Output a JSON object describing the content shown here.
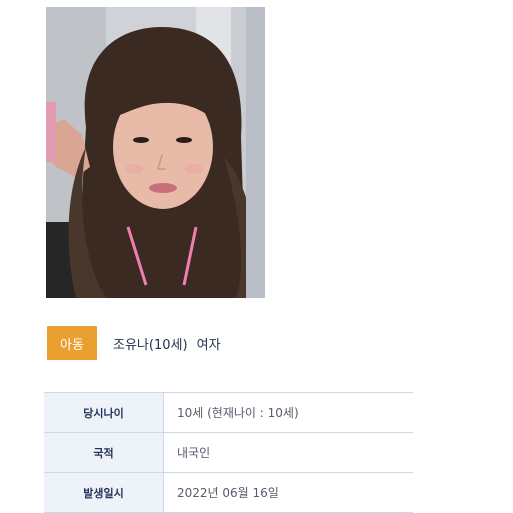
{
  "photo": {
    "icon": "child-photo"
  },
  "profile": {
    "category_badge": "아동",
    "name": "조유나(10세)",
    "gender": "여자"
  },
  "details": [
    {
      "label": "당시나이",
      "value": "10세 (현재나이 : 10세)"
    },
    {
      "label": "국적",
      "value": "내국인"
    },
    {
      "label": "발생일시",
      "value": "2022년 06월 16일"
    }
  ],
  "colors": {
    "badge": "#eaa030",
    "label_bg": "#eef3fa",
    "border": "#cfd8e6",
    "name_text": "#23324f"
  }
}
